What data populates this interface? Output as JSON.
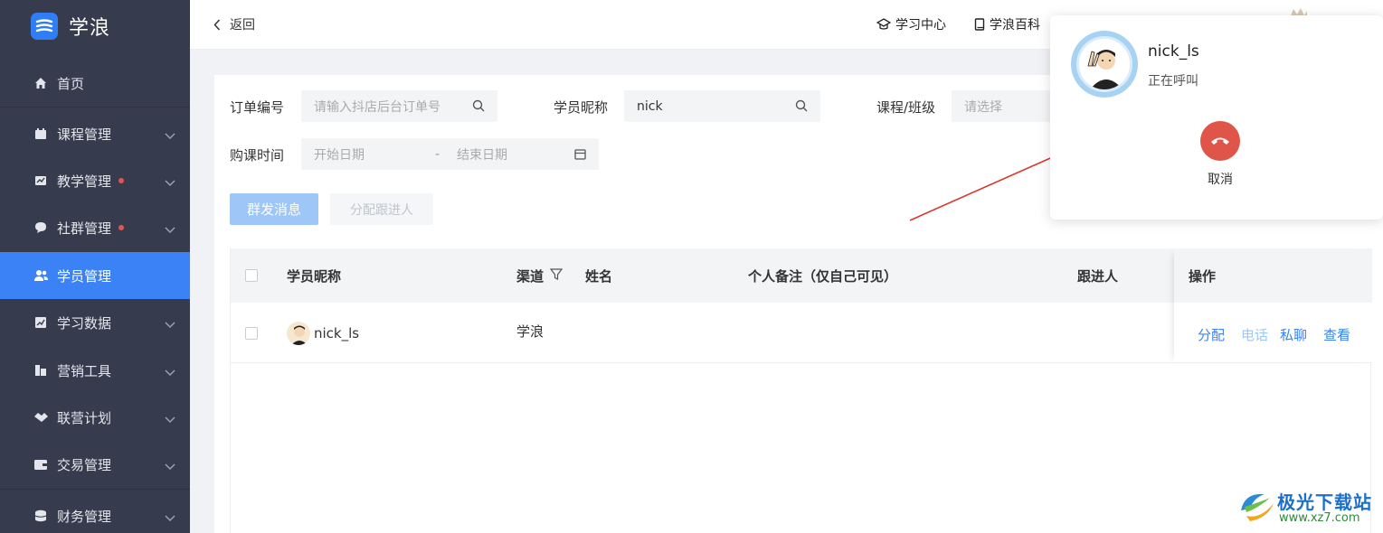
{
  "brand": {
    "name": "学浪",
    "accent": "#3b82f6"
  },
  "sidebar": {
    "items": [
      {
        "label": "首页",
        "icon": "home-icon",
        "dot": false,
        "chevron": false,
        "active": false
      },
      {
        "label": "课程管理",
        "icon": "course-icon",
        "dot": false,
        "chevron": true,
        "active": false
      },
      {
        "label": "教学管理",
        "icon": "teaching-icon",
        "dot": true,
        "chevron": true,
        "active": false
      },
      {
        "label": "社群管理",
        "icon": "community-icon",
        "dot": true,
        "chevron": true,
        "active": false
      },
      {
        "label": "学员管理",
        "icon": "students-icon",
        "dot": false,
        "chevron": false,
        "active": true
      },
      {
        "label": "学习数据",
        "icon": "chart-icon",
        "dot": false,
        "chevron": true,
        "active": false
      },
      {
        "label": "营销工具",
        "icon": "marketing-icon",
        "dot": false,
        "chevron": true,
        "active": false
      },
      {
        "label": "联营计划",
        "icon": "handshake-icon",
        "dot": false,
        "chevron": true,
        "active": false
      },
      {
        "label": "交易管理",
        "icon": "wallet-icon",
        "dot": false,
        "chevron": true,
        "active": false
      },
      {
        "label": "财务管理",
        "icon": "coins-icon",
        "dot": false,
        "chevron": true,
        "active": false
      }
    ]
  },
  "topbar": {
    "back_label": "返回",
    "links": [
      {
        "label": "学习中心",
        "icon": "graduation-cap-icon"
      },
      {
        "label": "学浪百科",
        "icon": "book-icon"
      }
    ]
  },
  "filters": {
    "order_no": {
      "label": "订单编号",
      "placeholder": "请输入抖店后台订单号"
    },
    "nickname": {
      "label": "学员昵称",
      "value": "nick"
    },
    "course": {
      "label": "课程/班级",
      "placeholder": "请选择"
    },
    "purchase_time": {
      "label": "购课时间",
      "start_placeholder": "开始日期",
      "separator": "-",
      "end_placeholder": "结束日期"
    }
  },
  "actions": {
    "broadcast": "群发消息",
    "assign_follower": "分配跟进人"
  },
  "table": {
    "headers": {
      "nickname": "学员昵称",
      "channel": "渠道",
      "name": "姓名",
      "note": "个人备注（仅自己可见）",
      "follower": "跟进人",
      "ops": "操作"
    },
    "rows": [
      {
        "nickname": "nick_ls",
        "channel": "学浪",
        "name": "",
        "note": "",
        "follower": ""
      }
    ],
    "row_actions": {
      "assign": "分配",
      "call": "电话",
      "chat": "私聊",
      "view": "查看"
    }
  },
  "call_popup": {
    "name": "nick_ls",
    "status": "正在呼叫",
    "cancel": "取消",
    "hangup_color": "#e0554a"
  },
  "watermark": {
    "text": "极光下载站",
    "url": "www.xz7.com"
  }
}
